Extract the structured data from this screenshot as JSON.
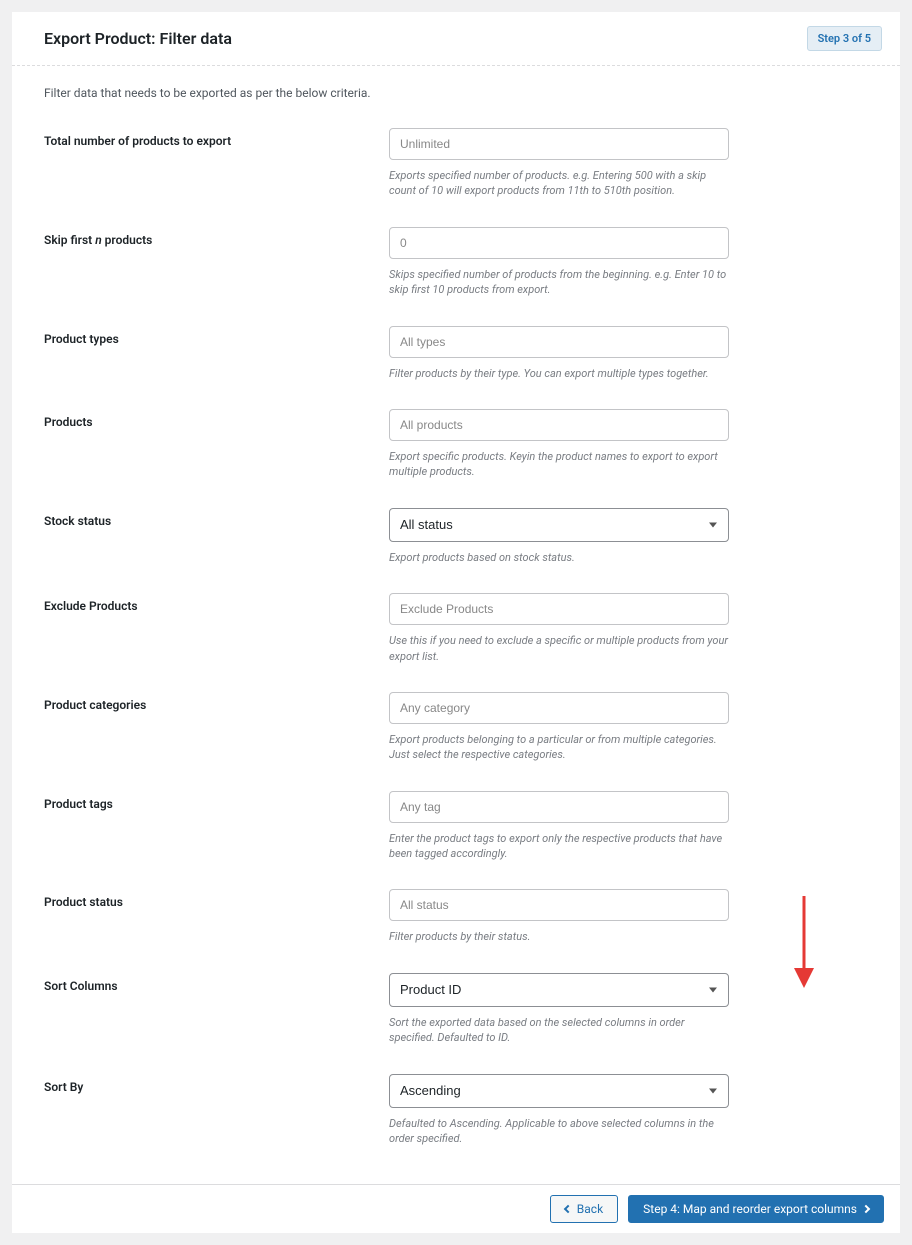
{
  "header": {
    "title": "Export Product: Filter data",
    "step_badge": "Step 3 of 5"
  },
  "intro": "Filter data that needs to be exported as per the below criteria.",
  "fields": {
    "total": {
      "label": "Total number of products to export",
      "placeholder": "Unlimited",
      "help": "Exports specified number of products. e.g. Entering 500 with a skip count of 10 will export products from 11th to 510th position."
    },
    "skip": {
      "label_pre": "Skip first ",
      "label_em": "n",
      "label_post": " products",
      "placeholder": "0",
      "help": "Skips specified number of products from the beginning. e.g. Enter 10 to skip first 10 products from export."
    },
    "types": {
      "label": "Product types",
      "placeholder": "All types",
      "help": "Filter products by their type. You can export multiple types together."
    },
    "products": {
      "label": "Products",
      "placeholder": "All products",
      "help": "Export specific products. Keyin the product names to export to export multiple products."
    },
    "stock": {
      "label": "Stock status",
      "selected": "All status",
      "help": "Export products based on stock status."
    },
    "exclude": {
      "label": "Exclude Products",
      "placeholder": "Exclude Products",
      "help": "Use this if you need to exclude a specific or multiple products from your export list."
    },
    "categories": {
      "label": "Product categories",
      "placeholder": "Any category",
      "help": "Export products belonging to a particular or from multiple categories. Just select the respective categories."
    },
    "tags": {
      "label": "Product tags",
      "placeholder": "Any tag",
      "help": "Enter the product tags to export only the respective products that have been tagged accordingly."
    },
    "status": {
      "label": "Product status",
      "placeholder": "All status",
      "help": "Filter products by their status."
    },
    "sort_columns": {
      "label": "Sort Columns",
      "selected": "Product ID",
      "help": "Sort the exported data based on the selected columns in order specified. Defaulted to ID."
    },
    "sort_by": {
      "label": "Sort By",
      "selected": "Ascending",
      "help": "Defaulted to Ascending. Applicable to above selected columns in the order specified."
    }
  },
  "footer": {
    "back": "Back",
    "next": "Step 4: Map and reorder export columns"
  },
  "annotation": {
    "arrow_color": "#e53935"
  }
}
